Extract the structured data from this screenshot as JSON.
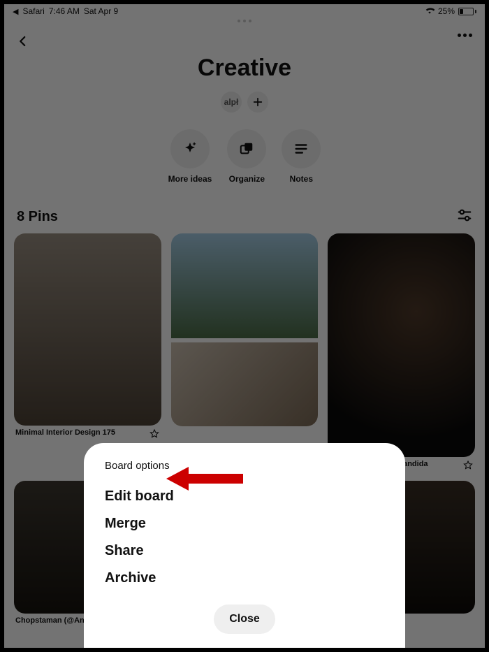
{
  "status_bar": {
    "back_app": "Safari",
    "time": "7:46 AM",
    "date": "Sat Apr 9",
    "battery_pct": "25%"
  },
  "header": {
    "title": "Creative",
    "avatar_text": "alpł"
  },
  "actions": [
    {
      "label": "More ideas"
    },
    {
      "label": "Organize"
    },
    {
      "label": "Notes"
    }
  ],
  "pins_bar": {
    "count_label": "8 Pins"
  },
  "pins": [
    {
      "title": "Minimal Interior Design 175"
    },
    {
      "title": ""
    },
    {
      "title": "R nineT Tracker la Bandida"
    },
    {
      "title": "Chopstaman (@Ant"
    },
    {
      "title": ""
    }
  ],
  "sheet": {
    "title": "Board options",
    "items": [
      "Edit board",
      "Merge",
      "Share",
      "Archive"
    ],
    "close_label": "Close"
  }
}
